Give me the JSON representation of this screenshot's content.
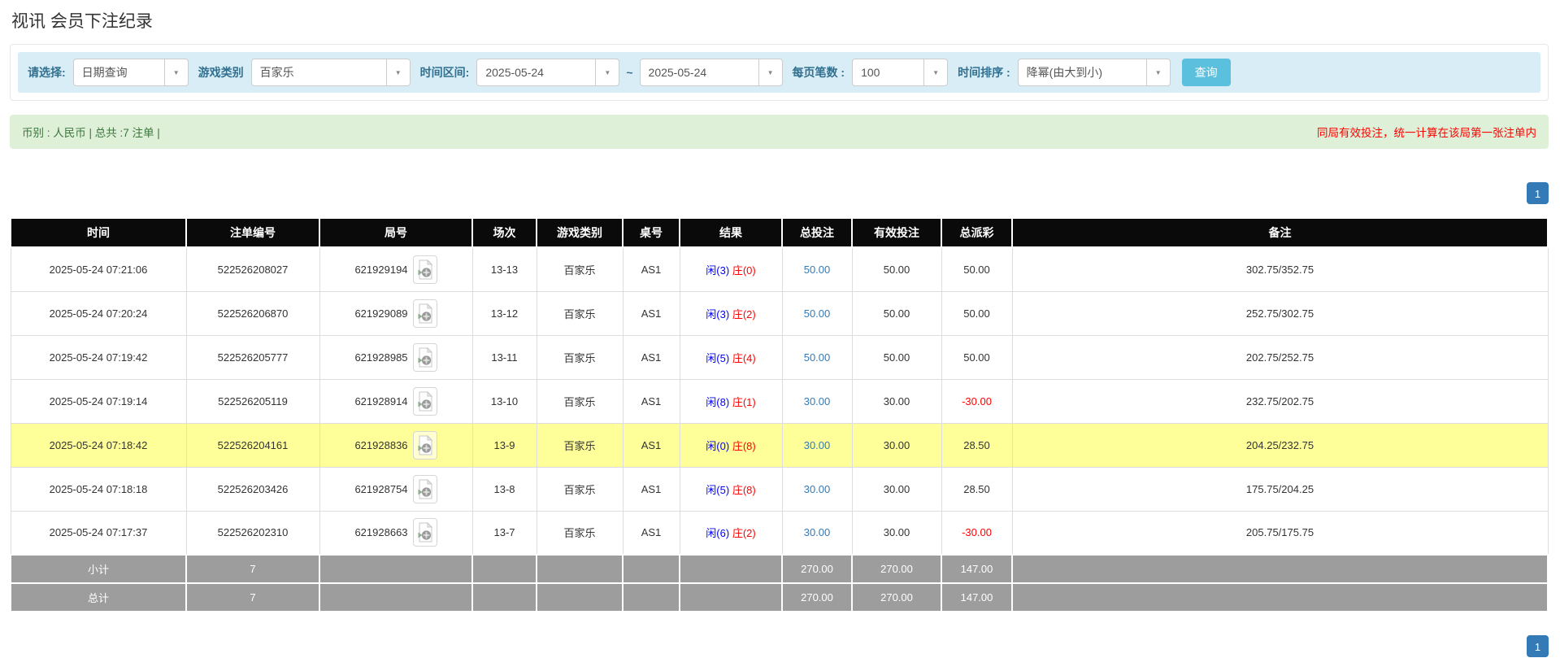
{
  "page": {
    "title": "视讯 会员下注纪录"
  },
  "colors": {
    "filter_bar_bg": "#d9edf7",
    "filter_label": "#31708f",
    "search_button_bg": "#5bc0de",
    "summary_bg": "#dff0d8",
    "summary_text_green": "#3c763d",
    "summary_text_red": "#ff0000",
    "table_header_bg": "#0a0a0a",
    "row_highlight_bg": "#ffff99",
    "footer_row_bg": "#9d9d9d",
    "link_blue": "#337ab7",
    "player_blue": "#0000ff",
    "banker_red": "#ff0000",
    "negative_red": "#ff0000",
    "pagination_bg": "#337ab7"
  },
  "filters": {
    "select_label": "请选择:",
    "select_value": "日期查询",
    "game_type_label": "游戏类别",
    "game_type_value": "百家乐",
    "time_range_label": "时间区间:",
    "date_from": "2025-05-24",
    "tilde": "~",
    "date_to": "2025-05-24",
    "page_size_label": "每页笔数 :",
    "page_size_value": "100",
    "sort_label": "时间排序 :",
    "sort_value": "降幂(由大到小)",
    "search_button": "查询",
    "caret": "▼"
  },
  "summary": {
    "left": "币别 : 人民币 | 总共 :7 注单 |",
    "right": "同局有效投注，统一计算在该局第一张注单内"
  },
  "pagination": {
    "current_page": "1"
  },
  "table": {
    "headers": [
      "时间",
      "注单编号",
      "局号",
      "场次",
      "游戏类别",
      "桌号",
      "结果",
      "总投注",
      "有效投注",
      "总派彩",
      "备注"
    ],
    "rows": [
      {
        "time": "2025-05-24 07:21:06",
        "bet_id": "522526208027",
        "round_id": "621929194",
        "session": "13-13",
        "game": "百家乐",
        "table_no": "AS1",
        "result_player": "闲(3)",
        "result_banker": "庄(0)",
        "total_bet": "50.00",
        "valid_bet": "50.00",
        "payout": "50.00",
        "remark": "302.75/352.75",
        "highlight": false
      },
      {
        "time": "2025-05-24 07:20:24",
        "bet_id": "522526206870",
        "round_id": "621929089",
        "session": "13-12",
        "game": "百家乐",
        "table_no": "AS1",
        "result_player": "闲(3)",
        "result_banker": "庄(2)",
        "total_bet": "50.00",
        "valid_bet": "50.00",
        "payout": "50.00",
        "remark": "252.75/302.75",
        "highlight": false
      },
      {
        "time": "2025-05-24 07:19:42",
        "bet_id": "522526205777",
        "round_id": "621928985",
        "session": "13-11",
        "game": "百家乐",
        "table_no": "AS1",
        "result_player": "闲(5)",
        "result_banker": "庄(4)",
        "total_bet": "50.00",
        "valid_bet": "50.00",
        "payout": "50.00",
        "remark": "202.75/252.75",
        "highlight": false
      },
      {
        "time": "2025-05-24 07:19:14",
        "bet_id": "522526205119",
        "round_id": "621928914",
        "session": "13-10",
        "game": "百家乐",
        "table_no": "AS1",
        "result_player": "闲(8)",
        "result_banker": "庄(1)",
        "total_bet": "30.00",
        "valid_bet": "30.00",
        "payout": "-30.00",
        "remark": "232.75/202.75",
        "highlight": false
      },
      {
        "time": "2025-05-24 07:18:42",
        "bet_id": "522526204161",
        "round_id": "621928836",
        "session": "13-9",
        "game": "百家乐",
        "table_no": "AS1",
        "result_player": "闲(0)",
        "result_banker": "庄(8)",
        "total_bet": "30.00",
        "valid_bet": "30.00",
        "payout": "28.50",
        "remark": "204.25/232.75",
        "highlight": true
      },
      {
        "time": "2025-05-24 07:18:18",
        "bet_id": "522526203426",
        "round_id": "621928754",
        "session": "13-8",
        "game": "百家乐",
        "table_no": "AS1",
        "result_player": "闲(5)",
        "result_banker": "庄(8)",
        "total_bet": "30.00",
        "valid_bet": "30.00",
        "payout": "28.50",
        "remark": "175.75/204.25",
        "highlight": false
      },
      {
        "time": "2025-05-24 07:17:37",
        "bet_id": "522526202310",
        "round_id": "621928663",
        "session": "13-7",
        "game": "百家乐",
        "table_no": "AS1",
        "result_player": "闲(6)",
        "result_banker": "庄(2)",
        "total_bet": "30.00",
        "valid_bet": "30.00",
        "payout": "-30.00",
        "remark": "205.75/175.75",
        "highlight": false
      }
    ],
    "subtotal": {
      "label": "小计",
      "count": "7",
      "total_bet": "270.00",
      "valid_bet": "270.00",
      "payout": "147.00"
    },
    "total": {
      "label": "总计",
      "count": "7",
      "total_bet": "270.00",
      "valid_bet": "270.00",
      "payout": "147.00"
    }
  }
}
